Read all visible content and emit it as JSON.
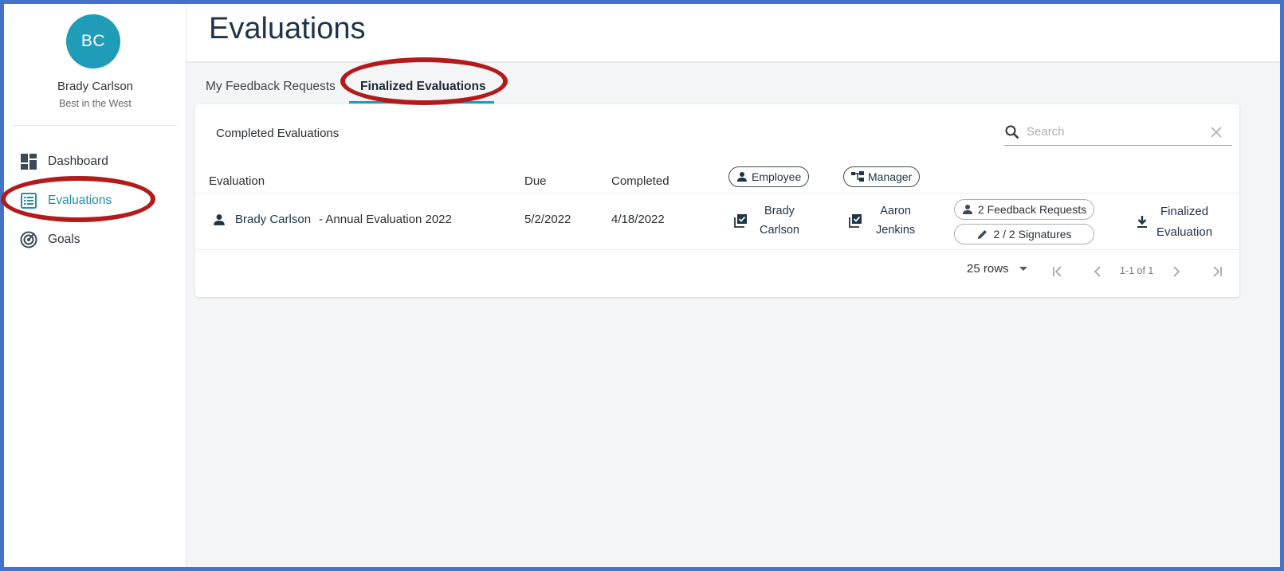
{
  "user": {
    "initials": "BC",
    "name": "Brady Carlson",
    "subtitle": "Best in the West"
  },
  "nav": {
    "items": [
      {
        "label": "Dashboard",
        "icon": "dashboard-icon"
      },
      {
        "label": "Evaluations",
        "icon": "list-icon",
        "active": true
      },
      {
        "label": "Goals",
        "icon": "target-icon"
      }
    ]
  },
  "header": {
    "title": "Evaluations"
  },
  "tabs": [
    {
      "label": "My Feedback Requests"
    },
    {
      "label": "Finalized Evaluations",
      "active": true
    }
  ],
  "card": {
    "title": "Completed Evaluations",
    "search_placeholder": "Search"
  },
  "table": {
    "columns": {
      "evaluation": "Evaluation",
      "due": "Due",
      "completed": "Completed",
      "employee": "Employee",
      "manager": "Manager"
    },
    "rows": [
      {
        "employee_name": "Brady Carlson",
        "evaluation_name": "- Annual Evaluation 2022",
        "due": "5/2/2022",
        "completed": "4/18/2022",
        "employee_first": "Brady",
        "employee_last": "Carlson",
        "manager_first": "Aaron",
        "manager_last": "Jenkins",
        "feedback_requests": "2 Feedback Requests",
        "signatures": "2 / 2 Signatures",
        "finalized_line1": "Finalized",
        "finalized_line2": "Evaluation"
      }
    ]
  },
  "pagination": {
    "rows_label": "25 rows",
    "range": "1-1 of 1"
  },
  "colors": {
    "accent": "#1f9db8",
    "highlight_oval": "#b31b1b",
    "frame": "#4472c4"
  }
}
